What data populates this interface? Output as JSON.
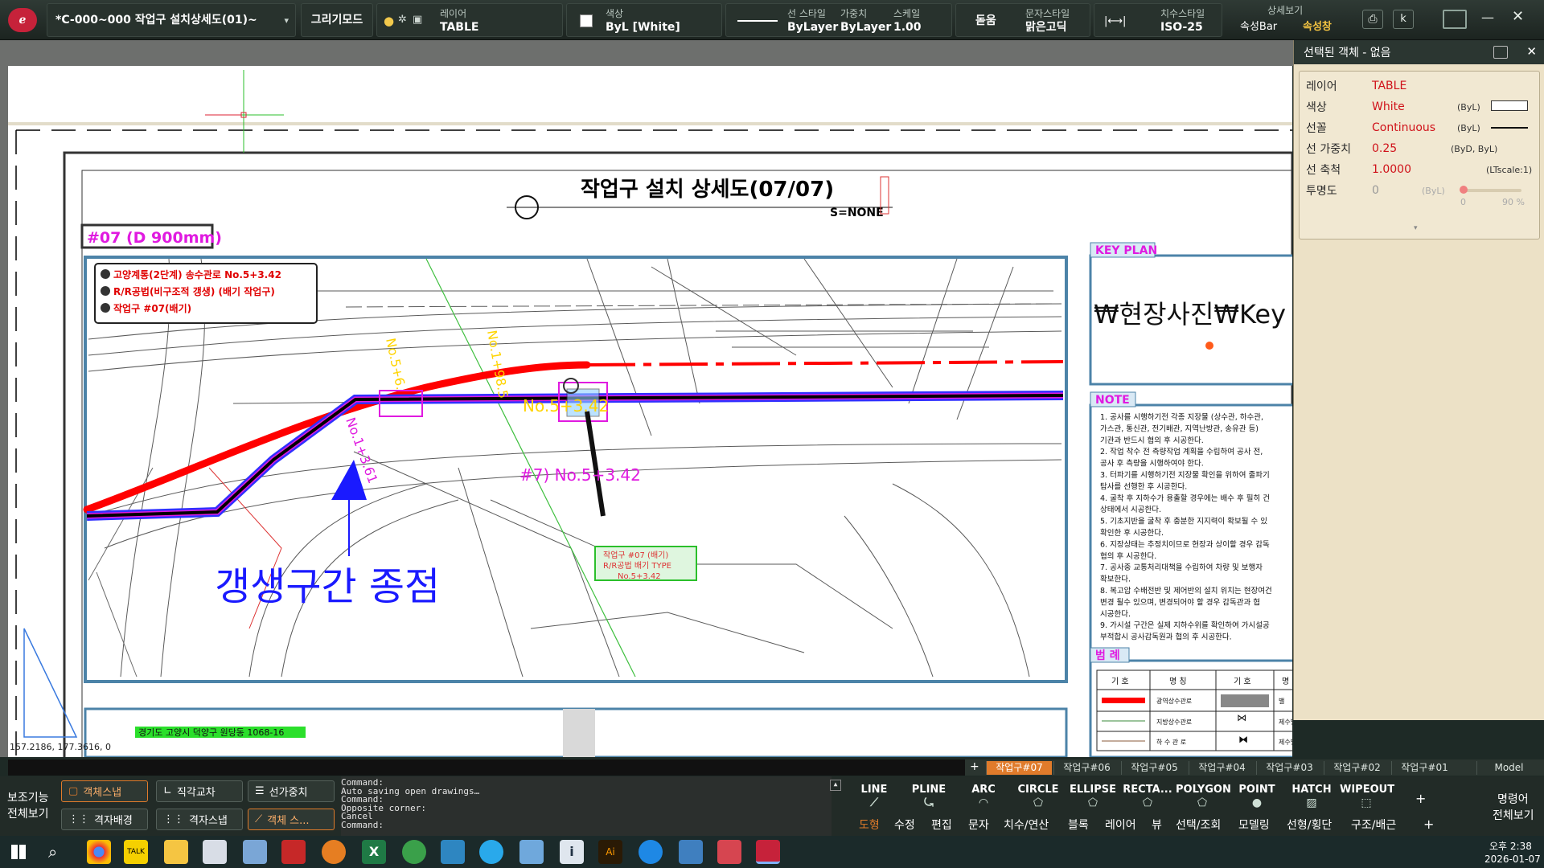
{
  "titlebar": {
    "doc_title": "*C-000~000 작업구 설치상세도(01)~",
    "draw_mode": "그리기모드",
    "layer_label": "레이어",
    "layer_value": "TABLE",
    "color_label": "색상",
    "color_value": "ByL [White]",
    "linestyle_label": "선 스타일",
    "linestyle_value": "ByLayer",
    "weight_label": "가중치",
    "weight_value": "ByLayer",
    "scale_label": "스케일",
    "scale_value": "1.00",
    "font_value": "돋움",
    "textstyle_label": "문자스타일",
    "textstyle_value": "맑은고딕",
    "dimstyle_label": "치수스타일",
    "dimstyle_value": "ISO-25",
    "detail_view_label": "상세보기",
    "speed_bar": "속성Bar",
    "speed_win": "속성창"
  },
  "drawing": {
    "title": "작업구 설치 상세도(07/07)",
    "scale_note": "S=NONE",
    "shaft_tag": "#07 (D 900mm)",
    "legend_lines": [
      "고양계통(2단계) 송수관로 No.5+3.42",
      "R/R공법(비구조적 갱생) (배기 작업구)",
      "작업구 #07(배기)"
    ],
    "key_plan_title": "KEY PLAN",
    "key_plan_text": "₩현장사진₩Key",
    "note_title": "NOTE",
    "notes": [
      "1. 공사를 시행하기전 각종 지장물 (상수관, 하수관,",
      "   가스관, 통신관, 전기배관, 지역난방관, 송유관 등)",
      "   기관과 반드시 협의 후 시공한다.",
      "2. 작업 착수 전 측량작업 계획을 수립하여 공사 전,",
      "   공사 후 측량을 시행하여야 한다.",
      "3. 터파기를 시행하기전 지장물 확인을 위하여 줄파기",
      "   탐사를 선행한 후 시공한다.",
      "4. 굴착 후 지하수가 용출할 경우에는 배수 후 필히 건",
      "   상태에서 시공한다.",
      "5. 기초지반을 굴착 후 충분한 지지력이 확보될 수 있",
      "   확인한 후 시공한다.",
      "6. 지장상태는 추정치이므로 현장과 상이할 경우 감독",
      "   협의 후 시공한다.",
      "7. 공사중 교통처리대책을 수립하여 차량 및 보행자",
      "   확보한다.",
      "8. 복고압 수배전반 및 제어반의 설치 위치는 현장여건",
      "   변경 될수 있으며, 변경되어야 할 경우 감독관과 협",
      "   시공한다.",
      "9. 가시설 구간은 실제 지하수위를 확인하여 가시설공",
      "   부적합시 공사감독원과 협의 후 시공한다."
    ],
    "legend_title": "범 례",
    "legend_headers": [
      "기 호",
      "명 칭",
      "기 호",
      "명"
    ],
    "legend_rows": [
      [
        "광역상수관로",
        "밸"
      ],
      [
        "지방상수관로",
        "제수밸브(지지체)"
      ],
      [
        "하 수 관 로",
        "제수밸브(분기)"
      ]
    ],
    "station_labels": [
      "No.5+3.42",
      "#7) No.5+3.42",
      "No.5+6.",
      "No.1+98.5",
      "No.1+3.61"
    ],
    "callout": [
      "작업구 #07 (배기)",
      "R/R공법 배기 TYPE",
      "No.5+3.42"
    ],
    "big_label": "갱생구간 종점",
    "address": "경기도 고양시 덕양구 원당동 1068-16",
    "coords": "157.2186, 177.3616, 0"
  },
  "properties": {
    "header": "선택된 객체 - 없음",
    "rows": [
      {
        "label": "레이어",
        "value": "TABLE",
        "extra": ""
      },
      {
        "label": "색상",
        "value": "White",
        "extra": "(ByL)"
      },
      {
        "label": "선꼴",
        "value": "Continuous",
        "extra": "(ByL)"
      },
      {
        "label": "선 가중치",
        "value": "0.25",
        "extra": "(ByD, ByL)"
      },
      {
        "label": "선 축척",
        "value": "1.0000",
        "extra": "(LTscale:1)"
      },
      {
        "label": "투명도",
        "value": "0",
        "extra": "(ByL)"
      }
    ],
    "transparency_min": "0",
    "transparency_max": "90 %",
    "transparency_level": 0.05
  },
  "layout_tabs": [
    "작업구#07",
    "작업구#06",
    "작업구#05",
    "작업구#04",
    "작업구#03",
    "작업구#02",
    "작업구#01",
    "Model"
  ],
  "left_panel": {
    "aux_label": "보조기능",
    "full_view": "전체보기",
    "buttons": [
      "객체스냅",
      "직각교차",
      "선가중치",
      "격자배경",
      "격자스냅",
      "객체 스..."
    ]
  },
  "command_log": [
    "Command:",
    "Auto saving open drawings…",
    "Command:",
    "Opposite corner:",
    "Cancel",
    "Command:"
  ],
  "tools": [
    "LINE",
    "PLINE",
    "ARC",
    "CIRCLE",
    "ELLIPSE",
    "RECTA...",
    "POLYGON",
    "POINT",
    "HATCH",
    "WIPEOUT"
  ],
  "categories": [
    "도형",
    "수정",
    "편집",
    "문자",
    "치수/연산",
    "블록",
    "레이어",
    "뷰",
    "선택/조회",
    "모델링",
    "선형/횡단",
    "구조/배근"
  ],
  "right_panel": {
    "cmd": "명령어",
    "full_view": "전체보기"
  },
  "taskbar": {
    "time": "오후 2:38",
    "date": "2026-01-07"
  },
  "colors": {
    "accent": "#e07b2b",
    "toolbar": "#28322d",
    "prop_panel": "#ece1c6"
  }
}
